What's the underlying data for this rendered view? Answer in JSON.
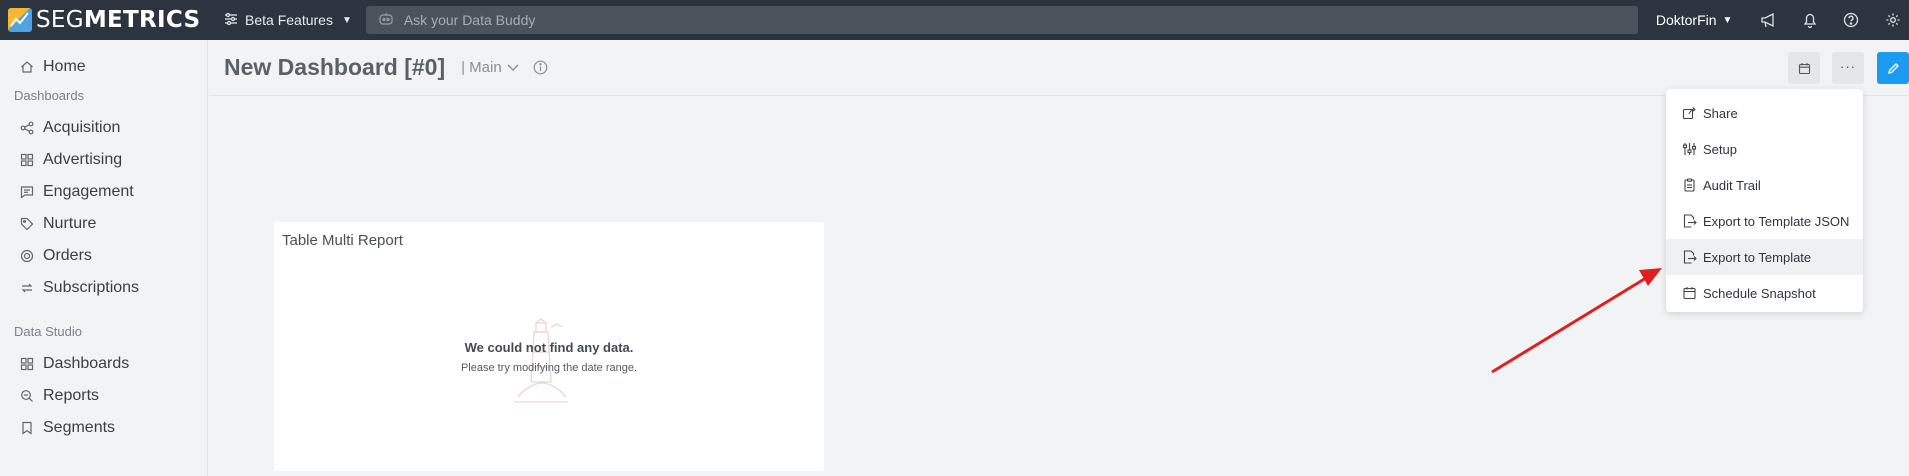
{
  "brand": {
    "name_light": "SEG",
    "name_bold": "METRICS"
  },
  "topbar": {
    "beta_label": "Beta Features",
    "search_placeholder": "Ask your Data Buddy",
    "account_label": "DoktorFin"
  },
  "sidebar": {
    "home": "Home",
    "dashboards_section": "Dashboards",
    "dashboards": [
      "Acquisition",
      "Advertising",
      "Engagement",
      "Nurture",
      "Orders",
      "Subscriptions"
    ],
    "studio_section": "Data Studio",
    "studio": [
      "Dashboards",
      "Reports",
      "Segments"
    ]
  },
  "header": {
    "title": "New Dashboard [#0]",
    "view_label": "| Main"
  },
  "card": {
    "title": "Table Multi Report",
    "empty_heading": "We could not find any data.",
    "empty_text": "Please try modifying the date range."
  },
  "menu": {
    "items": [
      "Share",
      "Setup",
      "Audit Trail",
      "Export to Template JSON",
      "Export to Template",
      "Schedule Snapshot"
    ],
    "highlighted": "Export to Template"
  },
  "colors": {
    "topbar": "#2c3440",
    "accent": "#1a9bf0",
    "arrow": "#e02020"
  }
}
